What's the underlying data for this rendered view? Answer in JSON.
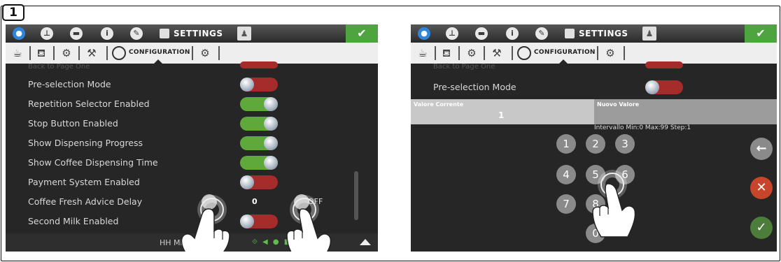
{
  "step": "1",
  "topbar": {
    "settings_label": "SETTINGS",
    "icons": [
      "water-drop-icon",
      "clock-icon",
      "cup-icon",
      "info-icon",
      "pencil-icon",
      "settings-icon",
      "user-icon",
      "wrench-icon"
    ]
  },
  "subbar": {
    "config_label": "CONFIGURATION"
  },
  "panel1": {
    "header_row": "Back to Page One",
    "rows": [
      {
        "label": "Pre-selection Mode",
        "state": "off"
      },
      {
        "label": "Repetition Selector Enabled",
        "state": "on"
      },
      {
        "label": "Stop Button Enabled",
        "state": "on"
      },
      {
        "label": "Show Dispensing Progress",
        "state": "on"
      },
      {
        "label": "Show Coffee Dispensing Time",
        "state": "on"
      },
      {
        "label": "Payment System Enabled",
        "state": "off"
      },
      {
        "label": "Coffee Fresh Advice Delay",
        "value": "0",
        "off_label": "OFF"
      },
      {
        "label": "Second Milk Enabled",
        "state": "off"
      }
    ],
    "status_time": "HH MM YYYY"
  },
  "panel2": {
    "row_label": "Pre-selection Mode",
    "current_label": "Valore Corrente",
    "current_value": "1",
    "new_label": "Nuovo Valore",
    "range": "Intervallo Min:0 Max:99 Step:1",
    "keys": [
      "1",
      "2",
      "3",
      "4",
      "5",
      "6",
      "7",
      "8",
      "0"
    ],
    "back_icon": "←",
    "cancel_icon": "✕",
    "confirm_icon": "✓"
  },
  "colors": {
    "toggle_on": "#5fa83a",
    "toggle_off": "#a62b2b",
    "wrench_bg": "#4ea43f",
    "cancel": "#c8452b",
    "confirm": "#4d7d3a"
  }
}
